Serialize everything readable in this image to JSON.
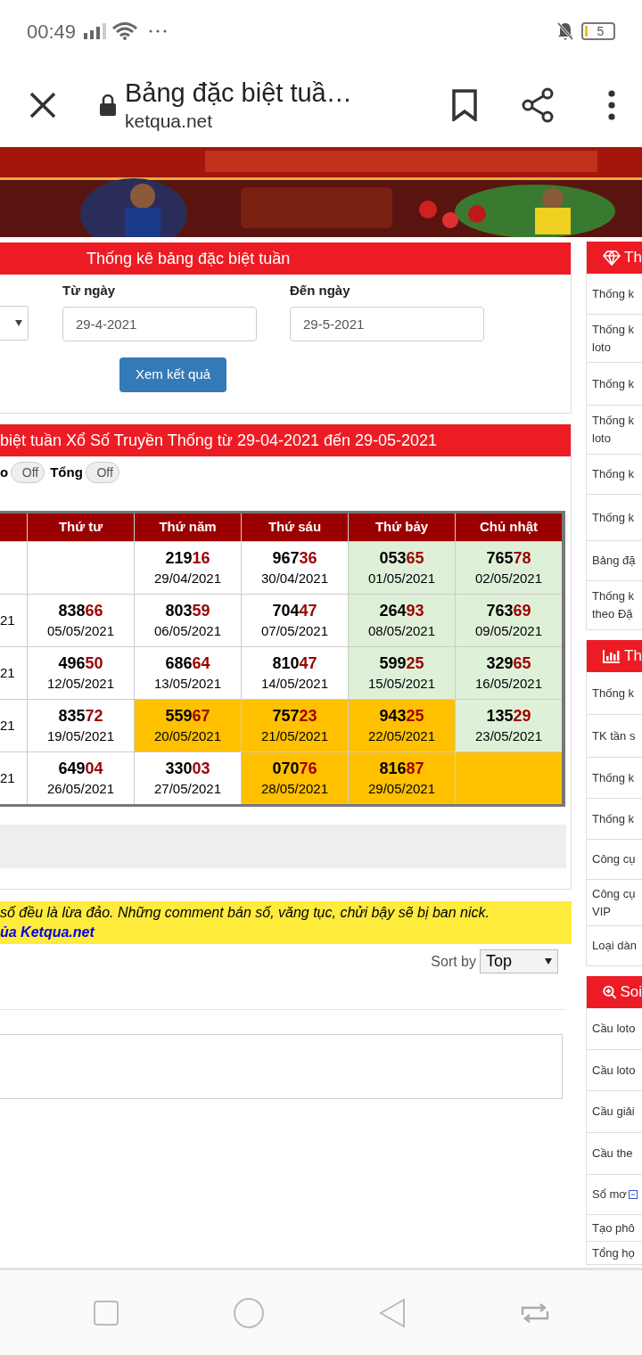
{
  "status_bar": {
    "time": "00:49",
    "battery": "5"
  },
  "browser": {
    "title": "Bảng đặc biệt tuầ…",
    "url": "ketqua.net"
  },
  "filter_panel": {
    "title": "Thống kê bảng đặc biệt tuần",
    "from_label": "Từ ngày",
    "from_value": "29-4-2021",
    "to_label": "Đến ngày",
    "to_value": "29-5-2021",
    "submit": "Xem kết quả"
  },
  "results_panel": {
    "title": "biệt tuần Xổ Số Truyền Thống từ 29-04-2021 đến 29-05-2021",
    "toggles": [
      {
        "label": "o",
        "state": "Off",
        "on": false
      },
      {
        "label": "Tổng",
        "state": "Off",
        "on": false
      }
    ],
    "table": {
      "columns": [
        "",
        "Thứ tư",
        "Thứ năm",
        "Thứ sáu",
        "Thứ bảy",
        "Chủ nhật"
      ],
      "rows": [
        [
          {},
          {},
          {
            "number": "21916",
            "date": "29/04/2021",
            "color": "#ffffff"
          },
          {
            "number": "96736",
            "date": "30/04/2021",
            "color": "#ffffff"
          },
          {
            "number": "05365",
            "date": "01/05/2021",
            "color": "#dff0d8"
          },
          {
            "number": "76578",
            "date": "02/05/2021",
            "color": "#dff0d8"
          }
        ],
        [
          {
            "date": "21",
            "color": "#ffffff"
          },
          {
            "number": "83866",
            "date": "05/05/2021",
            "color": "#ffffff"
          },
          {
            "number": "80359",
            "date": "06/05/2021",
            "color": "#ffffff"
          },
          {
            "number": "70447",
            "date": "07/05/2021",
            "color": "#ffffff"
          },
          {
            "number": "26493",
            "date": "08/05/2021",
            "color": "#dff0d8"
          },
          {
            "number": "76369",
            "date": "09/05/2021",
            "color": "#dff0d8"
          }
        ],
        [
          {
            "date": "21",
            "color": "#ffffff"
          },
          {
            "number": "49650",
            "date": "12/05/2021",
            "color": "#ffffff"
          },
          {
            "number": "68664",
            "date": "13/05/2021",
            "color": "#ffffff"
          },
          {
            "number": "81047",
            "date": "14/05/2021",
            "color": "#ffffff"
          },
          {
            "number": "59925",
            "date": "15/05/2021",
            "color": "#dff0d8"
          },
          {
            "number": "32965",
            "date": "16/05/2021",
            "color": "#dff0d8"
          }
        ],
        [
          {
            "date": "21",
            "color": "#ffffff"
          },
          {
            "number": "83572",
            "date": "19/05/2021",
            "color": "#ffffff"
          },
          {
            "number": "55967",
            "date": "20/05/2021",
            "color": "#ffc000"
          },
          {
            "number": "75723",
            "date": "21/05/2021",
            "color": "#ffc000"
          },
          {
            "number": "94325",
            "date": "22/05/2021",
            "color": "#ffc000"
          },
          {
            "number": "13529",
            "date": "23/05/2021",
            "color": "#dff0d8"
          }
        ],
        [
          {
            "date": "21",
            "color": "#ffffff"
          },
          {
            "number": "64904",
            "date": "26/05/2021",
            "color": "#ffffff"
          },
          {
            "number": "33003",
            "date": "27/05/2021",
            "color": "#ffffff"
          },
          {
            "number": "07076",
            "date": "28/05/2021",
            "color": "#ffc000"
          },
          {
            "number": "81687",
            "date": "29/05/2021",
            "color": "#ffc000"
          },
          {
            "color": "#ffc000"
          }
        ]
      ]
    }
  },
  "notice": {
    "text": "số đều là lừa đảo. Những comment bán số, văng tục, chửi bậy sẽ bị ban nick.",
    "link": "ủa Ketqua.net"
  },
  "comments": {
    "sort_label": "Sort by",
    "sort_value": "Top"
  },
  "sidebar": [
    {
      "title": "Th",
      "items": [
        "Thống k",
        "Thống k\nloto",
        "Thống k",
        "Thống k\nloto",
        "Thống k",
        "Thống k",
        "Bảng đặ",
        "Thống k\ntheo Đặ"
      ]
    },
    {
      "title": "Th",
      "items": [
        "Thống k",
        "TK tần s",
        "Thống k",
        "Thống k",
        "Công cụ",
        "Công cụ\nVIP",
        "Loại dàn"
      ]
    },
    {
      "title": "Soi",
      "items": [
        "Cầu loto",
        "Cầu loto",
        "Cầu giải",
        "Cầu the",
        "Sổ mơ",
        "Tạo phô",
        "Tổng họ"
      ]
    }
  ]
}
